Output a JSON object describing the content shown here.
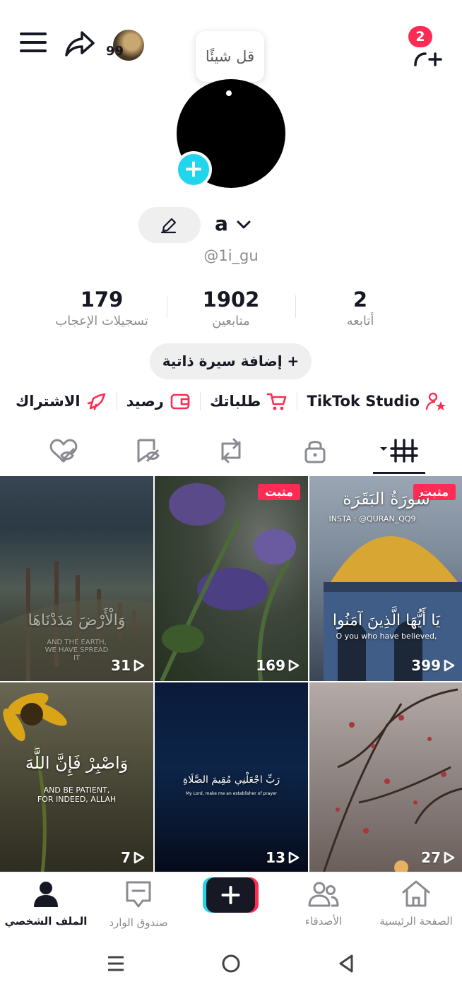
{
  "header": {
    "mini_count": "99",
    "notification_badge": "2",
    "note_bubble": "قل شيئًا"
  },
  "profile": {
    "name": "a",
    "username": "@1i_gu",
    "add_bio": "إضافة سيرة ذاتية"
  },
  "stats": [
    {
      "value": "2",
      "label": "أتابعه"
    },
    {
      "value": "1902",
      "label": "متابعين"
    },
    {
      "value": "179",
      "label": "تسجيلات الإعجاب"
    }
  ],
  "links": [
    {
      "label": "TikTok Studio",
      "icon": "person-star-icon"
    },
    {
      "label": "طلباتك",
      "icon": "cart-icon"
    },
    {
      "label": "رصيد",
      "icon": "wallet-icon"
    },
    {
      "label": "الاشتراك",
      "icon": "subscription-icon"
    }
  ],
  "tabs": [
    "videos-grid-icon",
    "lock-icon",
    "repost-icon",
    "saved-icon",
    "liked-icon"
  ],
  "videos": [
    {
      "views": "31",
      "pinned": false,
      "overlay": "وَالْأَرْضَ مَدَدْنَاهَا",
      "overlay_en": "AND THE EARTH, WE HAVE SPREAD IT"
    },
    {
      "views": "169",
      "pinned": true,
      "pin_label": "مثبت"
    },
    {
      "views": "399",
      "pinned": true,
      "pin_label": "مثبت",
      "overlay_top": "سُورَةُ البَقَرَة",
      "overlay_handle": "INSTA : @QURAN_QQ9",
      "overlay": "يَا أَيُّهَا الَّذِينَ آمَنُوا",
      "overlay_en": "O you who have believed,"
    },
    {
      "views": "7",
      "overlay": "وَاصْبِرْ فَإِنَّ اللَّهَ",
      "overlay_en": "AND BE PATIENT, FOR INDEED, ALLAH"
    },
    {
      "views": "13",
      "overlay": "رَبِّ اجْعَلْنِي مُقِيمَ الصَّلَاةِ",
      "overlay_en": "My Lord, make me an establisher of prayer"
    },
    {
      "views": "27"
    }
  ],
  "bottom_nav": [
    {
      "label": "الصفحة الرئيسية"
    },
    {
      "label": "الأصدقاء"
    },
    {
      "label": "صندوق الوارد"
    },
    {
      "label": "الملف الشخصي"
    }
  ],
  "colors": {
    "accent": "#fe2c55",
    "cyan": "#20d5ec",
    "text": "#161823",
    "muted": "#8a8b91"
  }
}
